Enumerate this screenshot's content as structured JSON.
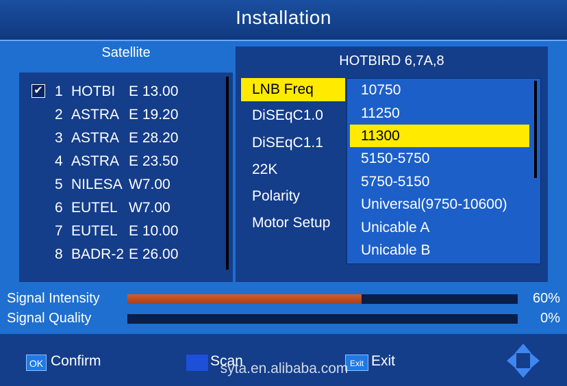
{
  "header": {
    "title": "Installation"
  },
  "satellite_panel": {
    "header": "Satellite",
    "items": [
      {
        "checked": true,
        "check_glyph": "✔",
        "num": "1",
        "name": "HOTBI",
        "pos": "E 13.00"
      },
      {
        "checked": false,
        "check_glyph": "",
        "num": "2",
        "name": "ASTRA",
        "pos": "E 19.20"
      },
      {
        "checked": false,
        "check_glyph": "",
        "num": "3",
        "name": "ASTRA",
        "pos": "E 28.20"
      },
      {
        "checked": false,
        "check_glyph": "",
        "num": "4",
        "name": "ASTRA",
        "pos": "E 23.50"
      },
      {
        "checked": false,
        "check_glyph": "",
        "num": "5",
        "name": "NILESA",
        "pos": "W7.00"
      },
      {
        "checked": false,
        "check_glyph": "",
        "num": "6",
        "name": "EUTEL",
        "pos": "W7.00"
      },
      {
        "checked": false,
        "check_glyph": "",
        "num": "7",
        "name": "EUTEL",
        "pos": "E 10.00"
      },
      {
        "checked": false,
        "check_glyph": "",
        "num": "8",
        "name": "BADR-2",
        "pos": "E 26.00"
      }
    ]
  },
  "settings_panel": {
    "satellite_name": "HOTBIRD 6,7A,8",
    "items": [
      {
        "label": "LNB Freq",
        "active": true
      },
      {
        "label": "DiSEqC1.0",
        "active": false
      },
      {
        "label": "DiSEqC1.1",
        "active": false
      },
      {
        "label": "22K",
        "active": false
      },
      {
        "label": "Polarity",
        "active": false
      },
      {
        "label": "Motor Setup",
        "active": false
      }
    ],
    "lnb_options": [
      {
        "label": "10750",
        "active": false
      },
      {
        "label": "11250",
        "active": false
      },
      {
        "label": "11300",
        "active": true
      },
      {
        "label": "5150-5750",
        "active": false
      },
      {
        "label": "5750-5150",
        "active": false
      },
      {
        "label": "Universal(9750-10600)",
        "active": false
      },
      {
        "label": "Unicable A",
        "active": false
      },
      {
        "label": "Unicable B",
        "active": false
      }
    ]
  },
  "signal": {
    "intensity_label": "Signal Intensity",
    "intensity_value": "60%",
    "intensity_fraction": 0.6,
    "quality_label": "Signal Quality",
    "quality_value": "0%",
    "quality_fraction": 0.0
  },
  "footer": {
    "ok_key": "OK",
    "confirm_label": "Confirm",
    "scan_label": "Scan",
    "exit_key": "Exit",
    "exit_label": "Exit",
    "watermark": "syta.en.alibaba.com",
    "nav_icon": "dpad-arrows-icon"
  },
  "colors": {
    "background": "#1e6fd0",
    "panel": "#143d8a",
    "highlight": "#ffea00",
    "intensity_bar": "#d85a28"
  }
}
